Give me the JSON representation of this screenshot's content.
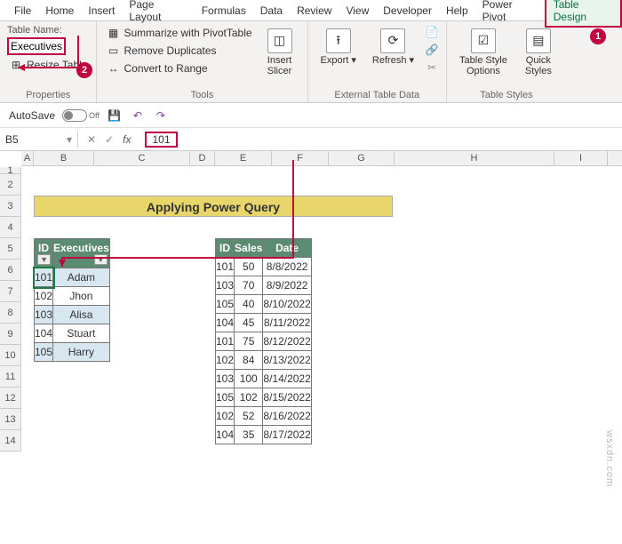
{
  "tabs": [
    "File",
    "Home",
    "Insert",
    "Page Layout",
    "Formulas",
    "Data",
    "Review",
    "View",
    "Developer",
    "Help",
    "Power Pivot",
    "Table Design"
  ],
  "active_tab": "Table Design",
  "properties": {
    "label": "Table Name:",
    "value": "Executives",
    "resize": "Resize Table",
    "group": "Properties"
  },
  "tools": {
    "summarize": "Summarize with PivotTable",
    "remove": "Remove Duplicates",
    "convert": "Convert to Range",
    "slicer": "Insert\nSlicer",
    "group": "Tools"
  },
  "external": {
    "export": "Export",
    "refresh": "Refresh",
    "group": "External Table Data"
  },
  "styles": {
    "options": "Table Style\nOptions",
    "quick": "Quick\nStyles",
    "group": "Table Styles"
  },
  "qat": {
    "autosave": "AutoSave",
    "off": "Off"
  },
  "namebox": "B5",
  "formula": "101",
  "title": "Applying Power Query",
  "table1": {
    "headers": [
      "ID",
      "Executives"
    ],
    "rows": [
      [
        "101",
        "Adam"
      ],
      [
        "102",
        "Jhon"
      ],
      [
        "103",
        "Alisa"
      ],
      [
        "104",
        "Stuart"
      ],
      [
        "105",
        "Harry"
      ]
    ]
  },
  "table2": {
    "headers": [
      "ID",
      "Sales",
      "Date"
    ],
    "rows": [
      [
        "101",
        "50",
        "8/8/2022"
      ],
      [
        "103",
        "70",
        "8/9/2022"
      ],
      [
        "105",
        "40",
        "8/10/2022"
      ],
      [
        "104",
        "45",
        "8/11/2022"
      ],
      [
        "101",
        "75",
        "8/12/2022"
      ],
      [
        "102",
        "84",
        "8/13/2022"
      ],
      [
        "103",
        "100",
        "8/14/2022"
      ],
      [
        "105",
        "102",
        "8/15/2022"
      ],
      [
        "102",
        "52",
        "8/16/2022"
      ],
      [
        "104",
        "35",
        "8/17/2022"
      ]
    ]
  },
  "cols": [
    "A",
    "B",
    "C",
    "D",
    "E",
    "F",
    "G",
    "H",
    "I"
  ],
  "rows": [
    "1",
    "2",
    "3",
    "4",
    "5",
    "6",
    "7",
    "8",
    "9",
    "10",
    "11",
    "12",
    "13",
    "14"
  ],
  "watermark": "wsxdn.com",
  "badges": {
    "one": "1",
    "two": "2"
  }
}
